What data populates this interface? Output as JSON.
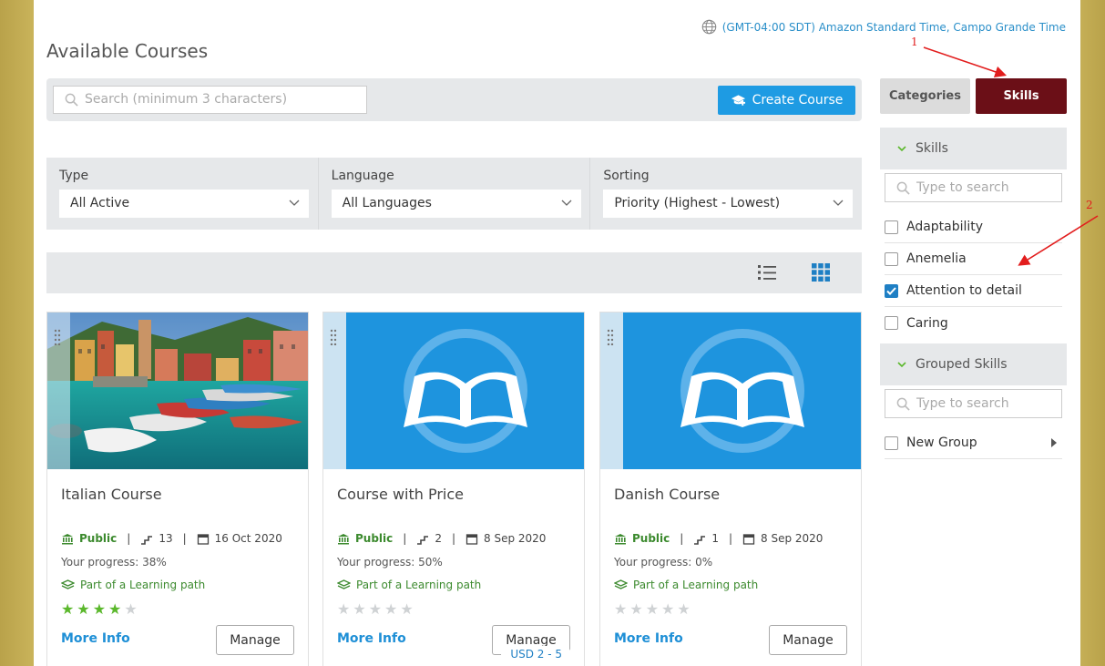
{
  "timezone": {
    "label": "(GMT-04:00 SDT) Amazon Standard Time, Campo Grande Time"
  },
  "page": {
    "title": "Available Courses"
  },
  "search": {
    "placeholder": "Search (minimum 3 characters)"
  },
  "create_button": {
    "label": "Create Course"
  },
  "filters": [
    {
      "label": "Type",
      "value": "All Active"
    },
    {
      "label": "Language",
      "value": "All Languages"
    },
    {
      "label": "Sorting",
      "value": "Priority (Highest - Lowest)"
    }
  ],
  "cards": [
    {
      "title": "Italian Course",
      "visibility": "Public",
      "lessons": "13",
      "date": "16 Oct 2020",
      "progress_label": "Your progress:",
      "progress_value": "38%",
      "learning_path": "Part of a Learning path",
      "rating": 4,
      "more_info": "More Info",
      "manage": "Manage",
      "image": "photo-cinque-terre",
      "price": null
    },
    {
      "title": "Course with Price",
      "visibility": "Public",
      "lessons": "2",
      "date": "8 Sep 2020",
      "progress_label": "Your progress:",
      "progress_value": "50%",
      "learning_path": "Part of a Learning path",
      "rating": 0,
      "more_info": "More Info",
      "manage": "Manage",
      "image": "book-placeholder",
      "price": "USD 2 - 5"
    },
    {
      "title": "Danish Course",
      "visibility": "Public",
      "lessons": "1",
      "date": "8 Sep 2020",
      "progress_label": "Your progress:",
      "progress_value": "0%",
      "learning_path": "Part of a Learning path",
      "rating": 0,
      "more_info": "More Info",
      "manage": "Manage",
      "image": "book-placeholder",
      "price": null
    }
  ],
  "sidebar": {
    "tabs": {
      "categories": "Categories",
      "skills": "Skills"
    },
    "skills_section": {
      "title": "Skills",
      "search_placeholder": "Type to search",
      "items": [
        {
          "label": "Adaptability",
          "checked": false
        },
        {
          "label": "Anemelia",
          "checked": false
        },
        {
          "label": "Attention to detail",
          "checked": true
        },
        {
          "label": "Caring",
          "checked": false
        }
      ]
    },
    "grouped_section": {
      "title": "Grouped Skills",
      "search_placeholder": "Type to search",
      "items": [
        {
          "label": "New Group",
          "checked": false
        }
      ]
    }
  },
  "annotations": {
    "one": "1",
    "two": "2"
  },
  "colors": {
    "accent": "#1e9be3",
    "skills_tab": "#6b0f17",
    "green": "#3c8a2e",
    "star_on": "#5bb82c"
  }
}
